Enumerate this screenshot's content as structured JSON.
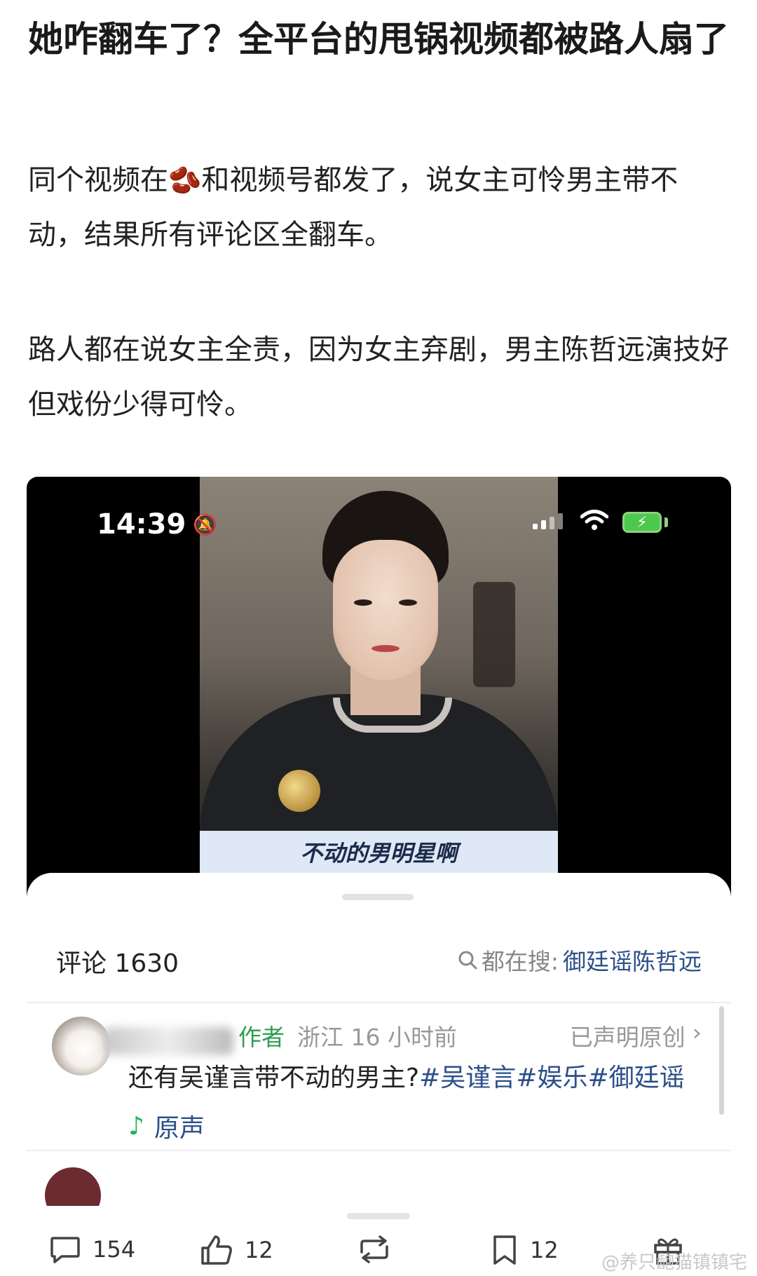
{
  "article": {
    "title": "她咋翻车了？全平台的甩锅视频都被路人扇了",
    "para1_a": "同个视频在",
    "para1_b": "和视频号都发了，说女主可怜男主带不动，结果所有评论区全翻车。",
    "para2": "路人都在说女主全责，因为女主弃剧，男主陈哲远演技好但戏份少得可怜。"
  },
  "screenshot": {
    "status_time": "14:39",
    "video_subtitle": "不动的男明星啊",
    "comment_count": "评论 1630",
    "search_hint_label": "都在搜:",
    "search_hint_keyword": "御廷谣陈哲远",
    "comment": {
      "author_tag": "作者",
      "location_time": "浙江 16 小时前",
      "original_label": "已声明原创",
      "text_plain": "还有吴谨言带不动的男主?",
      "text_tags": "#吴谨言#娱乐#御廷谣",
      "music_label": "原声"
    }
  },
  "toolbar": {
    "comment_count": "154",
    "like_count": "12",
    "favorite_count": "12"
  },
  "watermark": "@养只龅猫镇镇宅",
  "icons": {
    "bean": "coffee-bean-icon",
    "search": "search-icon",
    "chevron": "chevron-right-icon",
    "note": "music-note-icon",
    "comment": "comment-icon",
    "like": "thumbs-up-icon",
    "repost": "repost-icon",
    "favorite": "bookmark-icon",
    "gift": "gift-icon"
  }
}
